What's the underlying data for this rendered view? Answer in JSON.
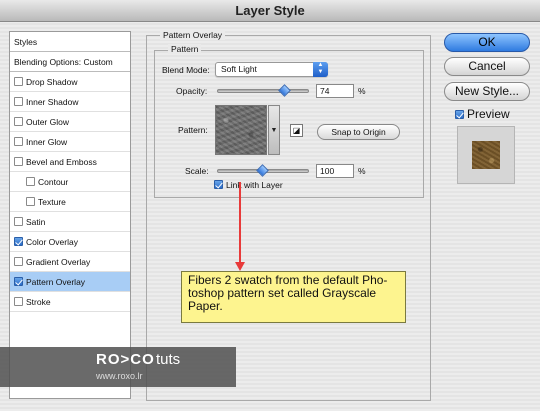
{
  "window": {
    "title": "Layer Style"
  },
  "sidebar": {
    "items": [
      {
        "label": "Styles",
        "checkbox": false,
        "checked": false,
        "indent": false,
        "selected": false,
        "header": true
      },
      {
        "label": "Blending Options: Custom",
        "checkbox": false,
        "checked": false,
        "indent": false,
        "selected": false,
        "header": true
      },
      {
        "label": "Drop Shadow",
        "checkbox": true,
        "checked": false,
        "indent": false,
        "selected": false
      },
      {
        "label": "Inner Shadow",
        "checkbox": true,
        "checked": false,
        "indent": false,
        "selected": false
      },
      {
        "label": "Outer Glow",
        "checkbox": true,
        "checked": false,
        "indent": false,
        "selected": false
      },
      {
        "label": "Inner Glow",
        "checkbox": true,
        "checked": false,
        "indent": false,
        "selected": false
      },
      {
        "label": "Bevel and Emboss",
        "checkbox": true,
        "checked": false,
        "indent": false,
        "selected": false
      },
      {
        "label": "Contour",
        "checkbox": true,
        "checked": false,
        "indent": true,
        "selected": false
      },
      {
        "label": "Texture",
        "checkbox": true,
        "checked": false,
        "indent": true,
        "selected": false
      },
      {
        "label": "Satin",
        "checkbox": true,
        "checked": false,
        "indent": false,
        "selected": false
      },
      {
        "label": "Color Overlay",
        "checkbox": true,
        "checked": true,
        "indent": false,
        "selected": false
      },
      {
        "label": "Gradient Overlay",
        "checkbox": true,
        "checked": false,
        "indent": false,
        "selected": false
      },
      {
        "label": "Pattern Overlay",
        "checkbox": true,
        "checked": true,
        "indent": false,
        "selected": true
      },
      {
        "label": "Stroke",
        "checkbox": true,
        "checked": false,
        "indent": false,
        "selected": false
      }
    ]
  },
  "panel": {
    "group_title": "Pattern Overlay",
    "subgroup_title": "Pattern",
    "blend_mode_label": "Blend Mode:",
    "blend_mode_value": "Soft Light",
    "opacity_label": "Opacity:",
    "opacity_value": "74",
    "opacity_unit": "%",
    "opacity_fraction": 0.74,
    "pattern_label": "Pattern:",
    "snap_button": "Snap to Origin",
    "scale_label": "Scale:",
    "scale_value": "100",
    "scale_unit": "%",
    "link_label": "Link with Layer",
    "link_checked": true
  },
  "callout": {
    "text": "Fibers 2 swatch from the default Pho-toshop pattern set called Grayscale Paper."
  },
  "buttons": {
    "ok": "OK",
    "cancel": "Cancel",
    "new_style": "New Style..."
  },
  "preview": {
    "label": "Preview",
    "checked": true
  },
  "watermark": {
    "logo": "RO>CO",
    "tuts": "tuts",
    "url": "www.roxo.lr"
  },
  "colors": {
    "accent": "#2f7be0",
    "callout_bg": "#fdf48f",
    "arrow": "#e83a3a",
    "selection": "#a8cdf5"
  },
  "icons": {
    "pattern_menu": "triangle-down-icon",
    "new_preset": "new-preset-icon",
    "select_arrows": "updown-arrows-icon"
  }
}
